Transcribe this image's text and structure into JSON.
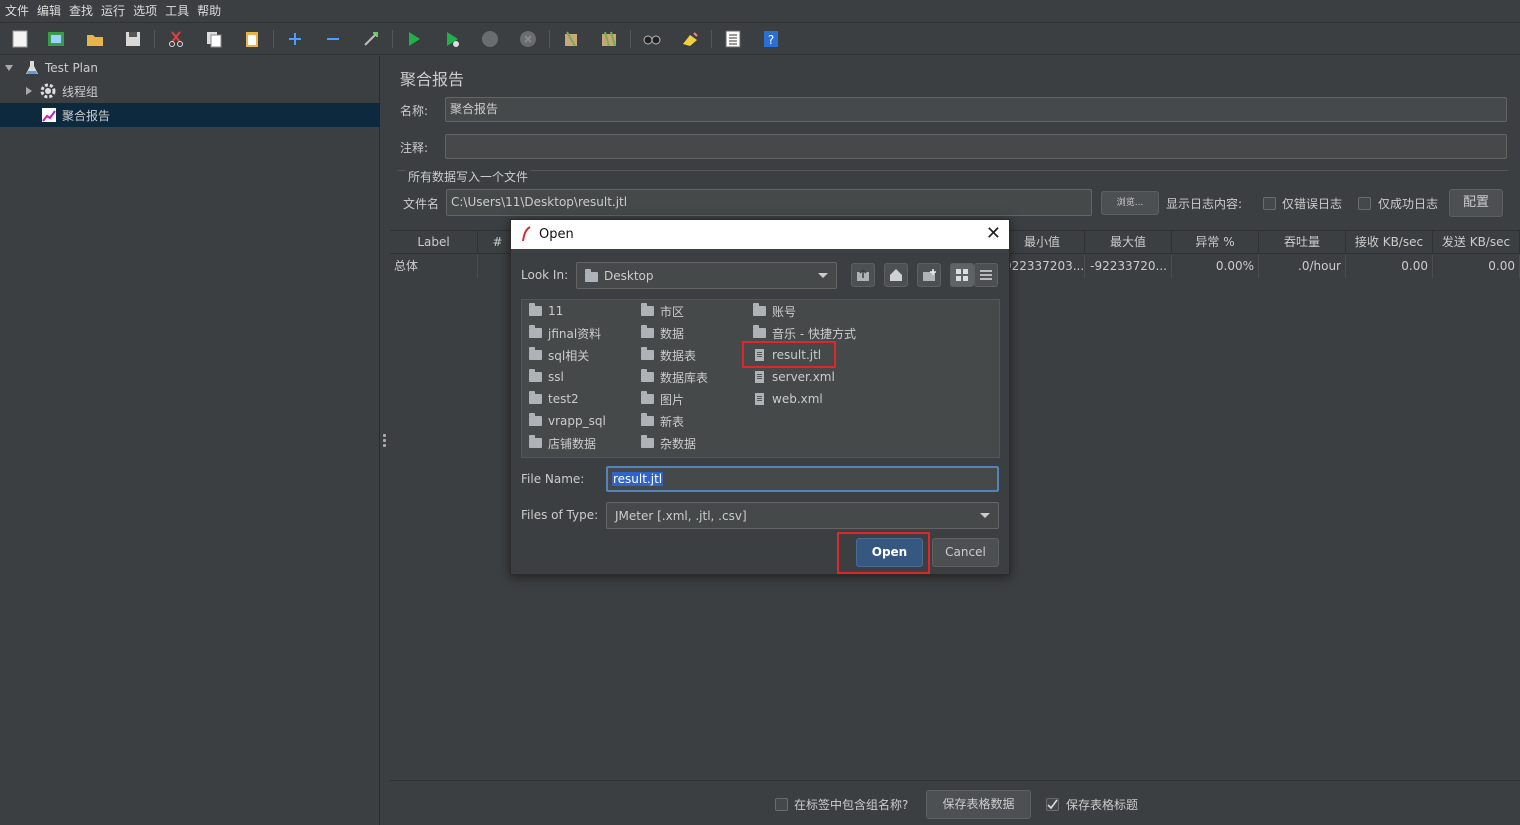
{
  "menu": [
    "文件",
    "编辑",
    "查找",
    "运行",
    "选项",
    "工具",
    "帮助"
  ],
  "tree": {
    "items": [
      {
        "label": "Test Plan"
      },
      {
        "label": "线程组"
      },
      {
        "label": "聚合报告"
      }
    ]
  },
  "panel": {
    "title": "聚合报告",
    "name_label": "名称:",
    "name_value": "聚合报告",
    "comment_label": "注释:",
    "comment_value": "",
    "group_label": "所有数据写入一个文件",
    "filename_label": "文件名",
    "filename_value": "C:\\Users\\11\\Desktop\\result.jtl",
    "browse_label": "浏览...",
    "log_label": "显示日志内容:",
    "errors_only": "仅错误日志",
    "success_only": "仅成功日志",
    "config_label": "配置"
  },
  "table": {
    "headers": [
      "Label",
      "#",
      "最小值",
      "最大值",
      "异常 %",
      "吞吐量",
      "接收 KB/sec",
      "发送 KB/sec"
    ],
    "row": {
      "label": "总体",
      "min": "922337203...",
      "max": "-92233720...",
      "error": "0.00%",
      "throughput": ".0/hour",
      "received": "0.00",
      "sent": "0.00"
    }
  },
  "bottom": {
    "include_group": "在标签中包含组名称?",
    "save_data": "保存表格数据",
    "save_header": "保存表格标题"
  },
  "dialog": {
    "title": "Open",
    "look_in_label": "Look In:",
    "look_in_value": "Desktop",
    "files": {
      "col1": [
        "11",
        "jfinal资料",
        "sql相关",
        "ssl",
        "test2",
        "vrapp_sql",
        "店铺数据"
      ],
      "col2": [
        "市区",
        "数据",
        "数据表",
        "数据库表",
        "图片",
        "新表",
        "杂数据"
      ],
      "col3_folders": [
        "账号",
        "音乐 - 快捷方式"
      ],
      "col3_files": [
        "result.jtl",
        "server.xml",
        "web.xml"
      ]
    },
    "file_name_label": "File Name:",
    "file_name_value": "result.jtl",
    "files_of_type_label": "Files of Type:",
    "files_of_type_value": "JMeter [.xml, .jtl, .csv]",
    "open_label": "Open",
    "cancel_label": "Cancel"
  },
  "colors": {
    "background": "#3c3f41",
    "selection": "#0d293e",
    "highlight": "#e0262b",
    "primary_button": "#365880"
  }
}
